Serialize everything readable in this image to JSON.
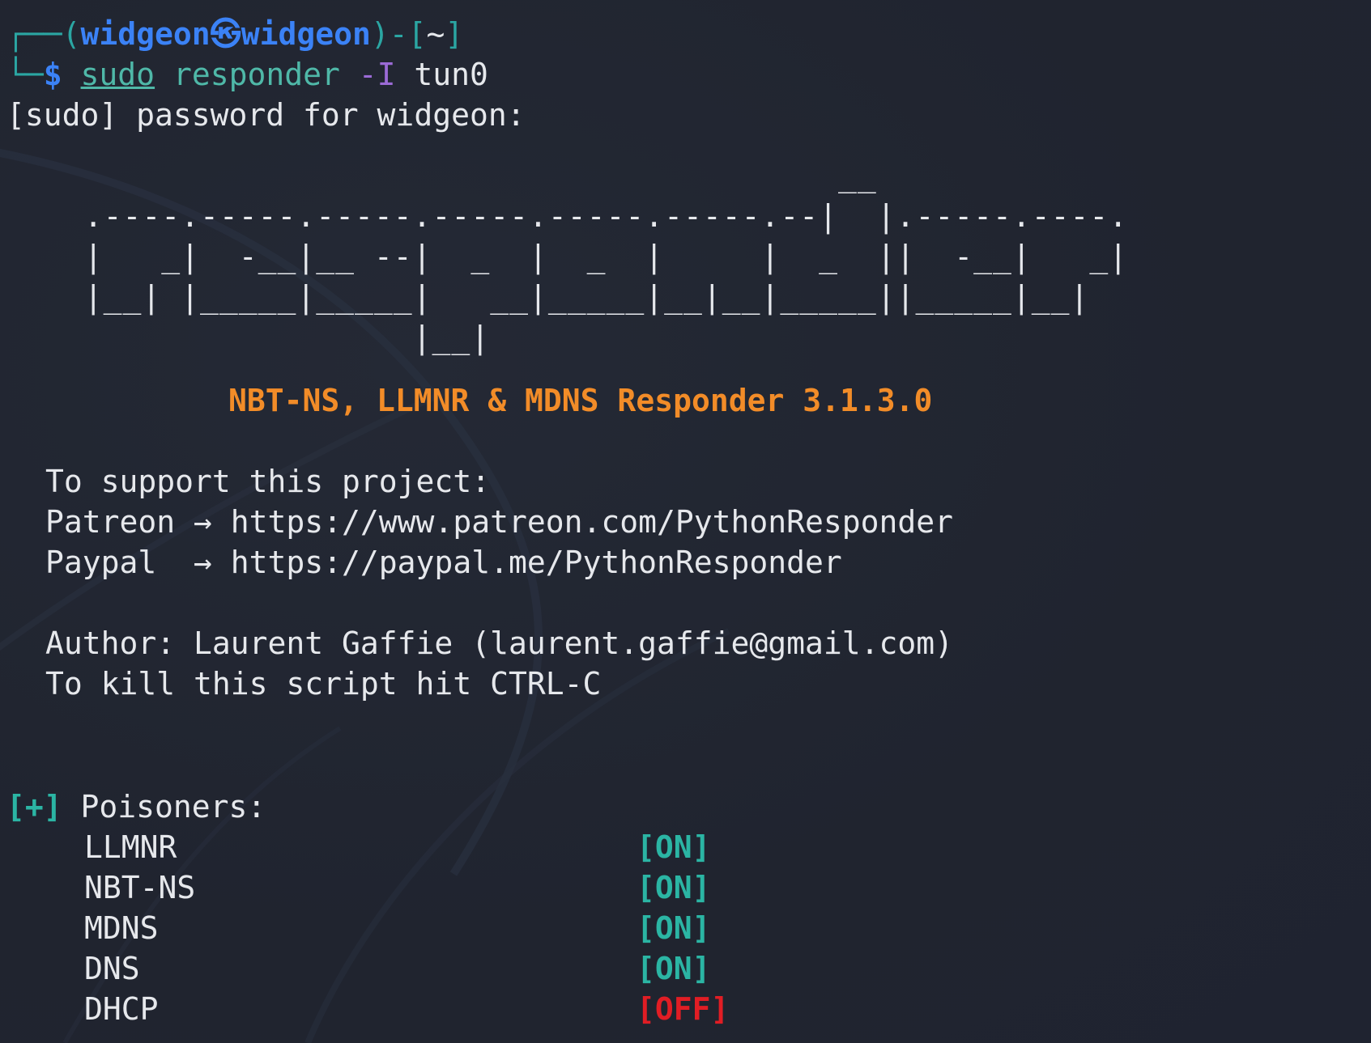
{
  "prompt": {
    "box_top_left": "┌──(",
    "user": "widgeon",
    "at_symbol": "㉿",
    "host": "widgeon",
    "box_mid": ")-[",
    "cwd": "~",
    "box_end": "]",
    "box_bottom": "└─",
    "dollar": "$"
  },
  "command": {
    "sudo": "sudo",
    "program": "responder",
    "flag": "-I",
    "arg": "tun0"
  },
  "sudo_prompt": "[sudo] password for widgeon:",
  "banner": {
    "ascii_art": "                                         __\n  .----.-----.-----.-----.-----.-----.--|  |.-----.----.\n  |   _|  -__|__ --|  _  |  _  |     |  _  ||  -__|   _|\n  |__| |_____|_____|   __|_____|__|__|_____||_____|__|\n                   |__|",
    "title": "NBT-NS, LLMNR & MDNS Responder 3.1.3.0"
  },
  "support": {
    "heading": "To support this project:",
    "patreon": "Patreon → https://www.patreon.com/PythonResponder",
    "paypal": "Paypal  → https://paypal.me/PythonResponder"
  },
  "author": "Author: Laurent Gaffie (laurent.gaffie@gmail.com)",
  "kill_hint": "To kill this script hit CTRL-C",
  "poisoners": {
    "marker": "[+]",
    "heading": "Poisoners:",
    "items": [
      {
        "name": "LLMNR",
        "status": "[ON]"
      },
      {
        "name": "NBT-NS",
        "status": "[ON]"
      },
      {
        "name": "MDNS",
        "status": "[ON]"
      },
      {
        "name": "DNS",
        "status": "[ON]"
      },
      {
        "name": "DHCP",
        "status": "[OFF]"
      }
    ]
  },
  "colors": {
    "background": "#20242f",
    "prompt_blue": "#3b82f6",
    "command_teal": "#4fb8a8",
    "flag_purple": "#9b6bd6",
    "banner_orange": "#f28c28",
    "on_green": "#2bb5a4",
    "off_red": "#e11d24"
  }
}
